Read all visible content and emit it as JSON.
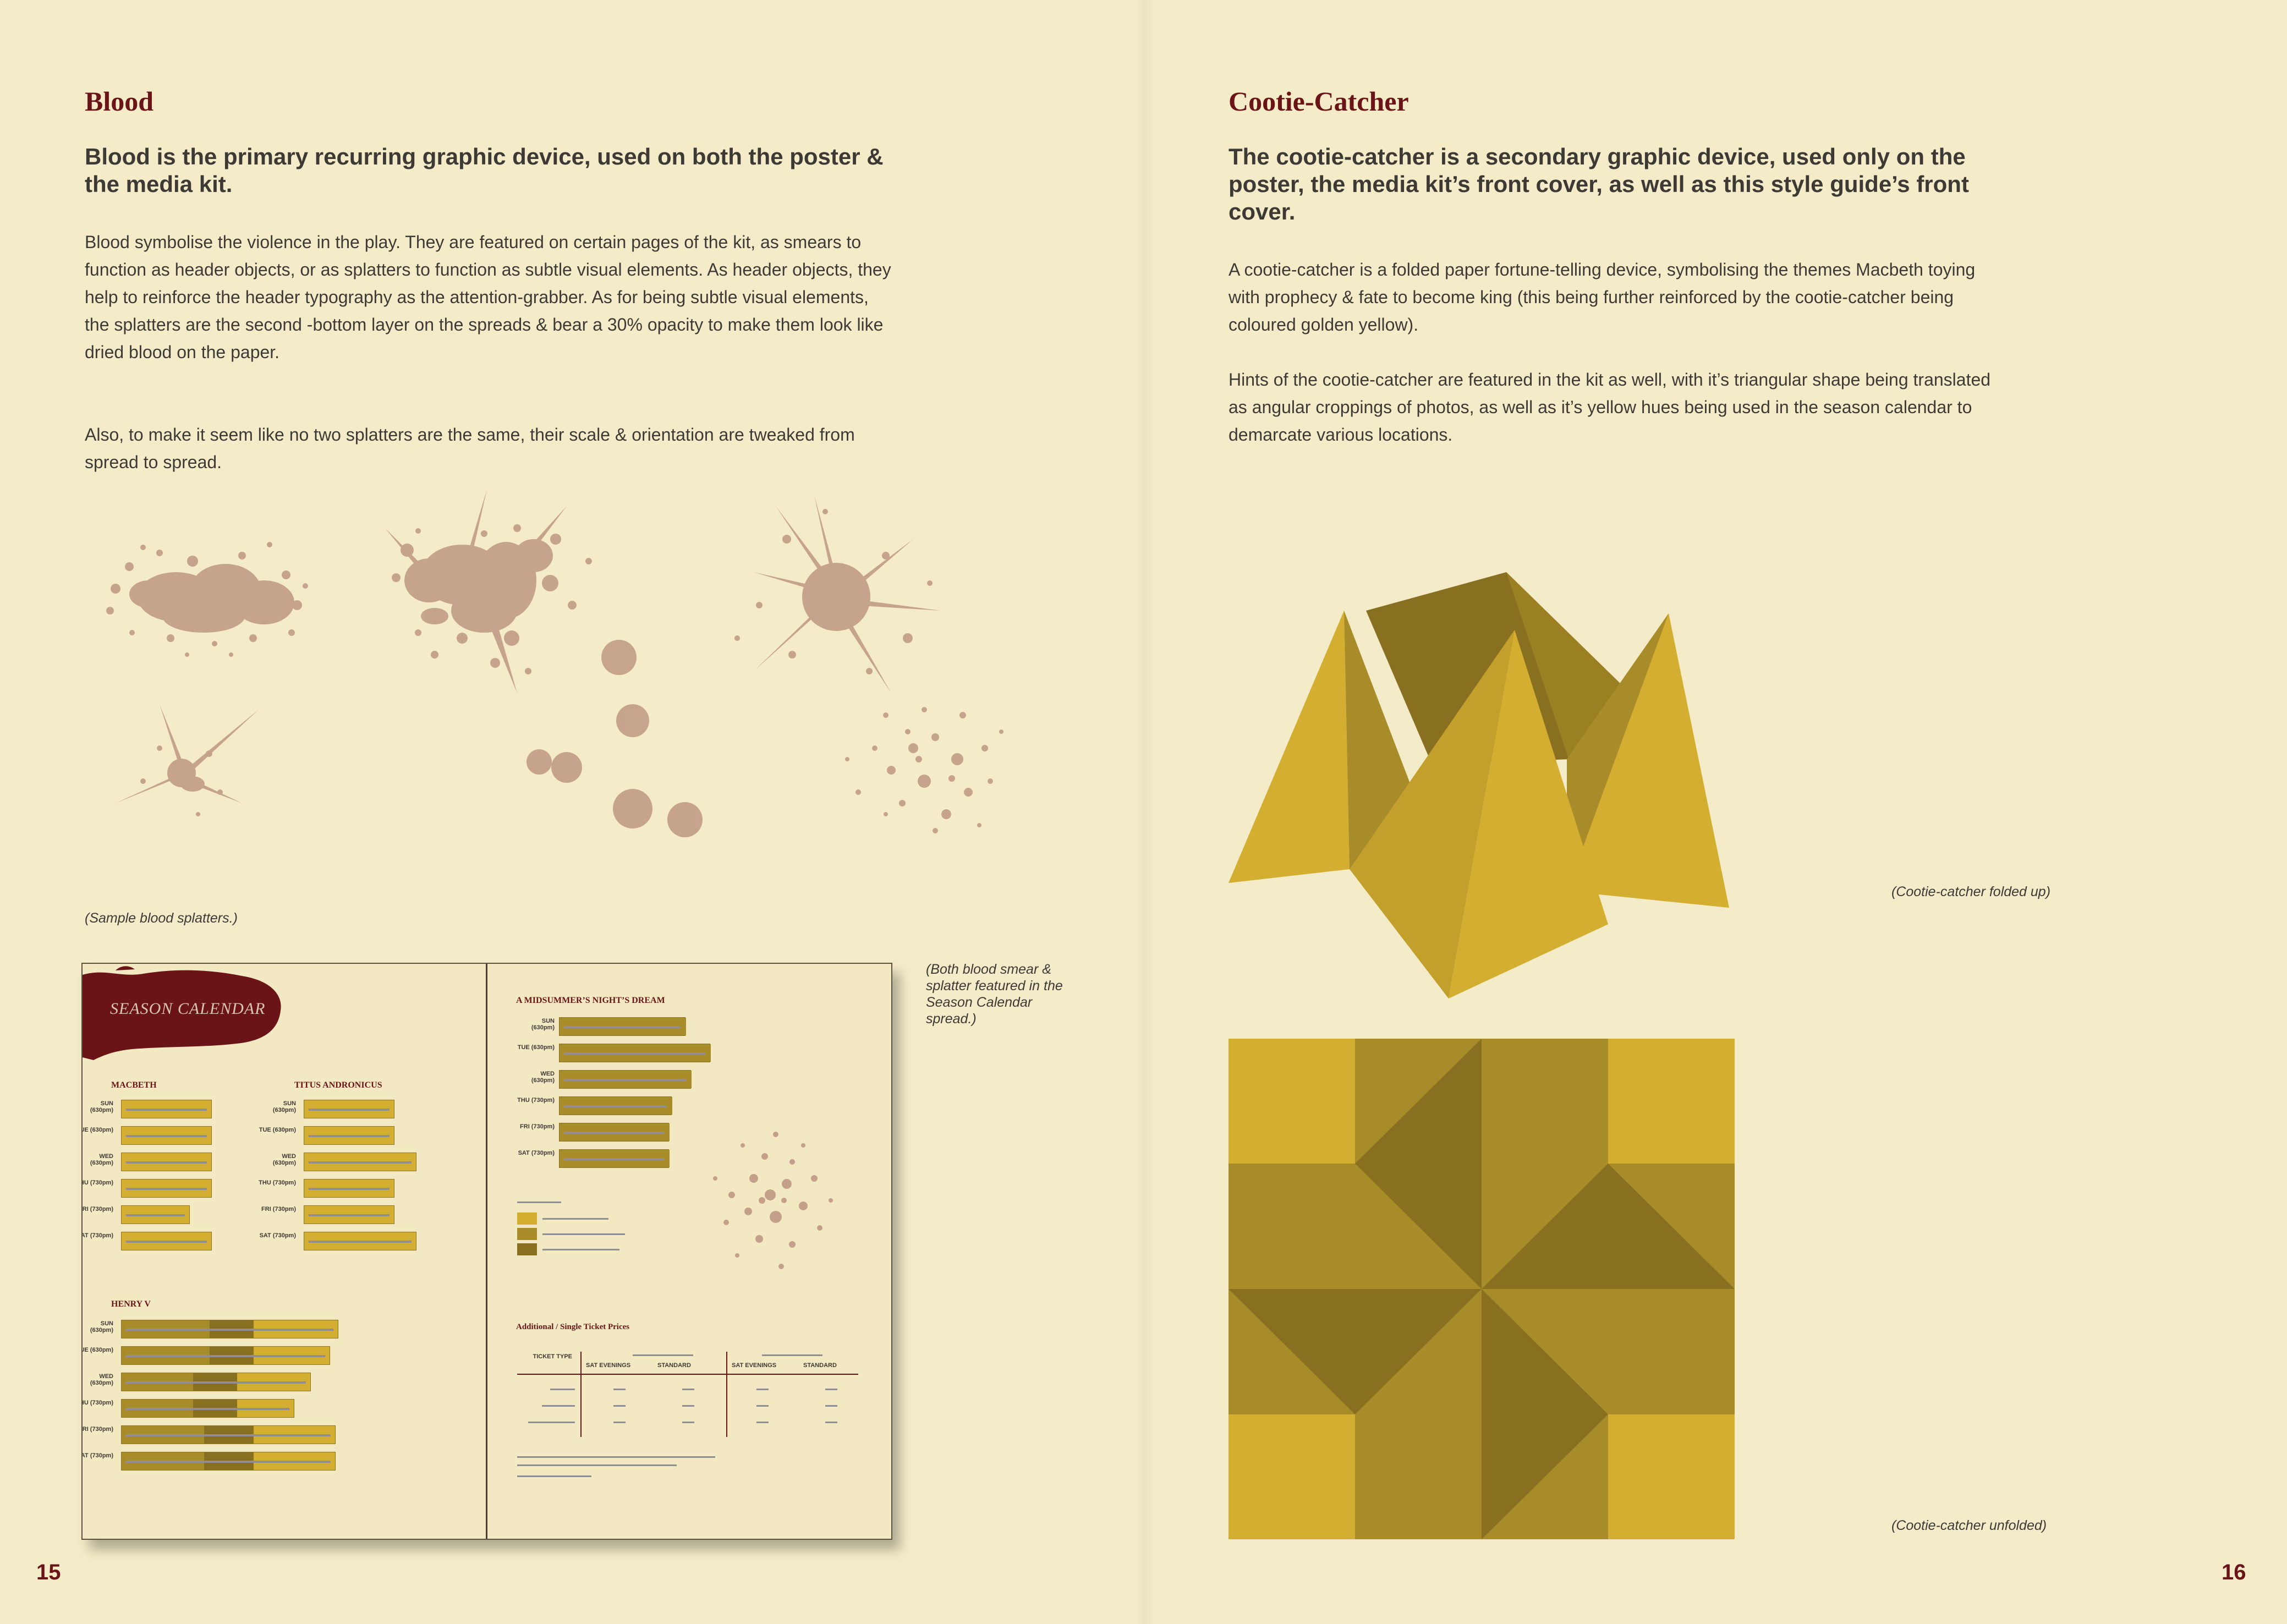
{
  "left": {
    "heading": "Blood",
    "lead": "Blood is the primary recurring graphic device, used on both the poster & the media kit.",
    "body1": "Blood symbolise the violence in the play. They are featured on certain pages of the kit, as smears to function as header objects, or as splatters to function as subtle visual elements. As header objects, they help to reinforce the header typography as the attention-grabber. As for being subtle visual elements, the splatters are the second -bottom layer on the spreads & bear a 30% opacity to make them look like dried blood on the paper.",
    "body2": "Also, to make it seem like no two splatters are the same, their scale & orientation are tweaked from spread to spread.",
    "splatter_caption": "(Sample blood splatters.)",
    "spread_caption": "(Both blood smear & splatter featured in the Season Calendar spread.)",
    "page_number": "15"
  },
  "right": {
    "heading": "Cootie-Catcher",
    "lead": "The cootie-catcher is a secondary graphic device, used only on the poster, the media kit’s front cover, as well as this style guide’s front cover.",
    "body1": "A cootie-catcher is a folded paper fortune-telling device, symbolising the themes Macbeth toying with prophecy & fate to become king (this being further reinforced by the cootie-catcher being coloured golden yellow).",
    "body2": "Hints of the cootie-catcher are featured in the kit as well, with it’s triangular shape being translated as angular croppings of photos, as well as it’s yellow hues being used in the season calendar to demarcate various locations.",
    "folded_caption": "(Cootie-catcher folded up)",
    "unfolded_caption": "(Cootie-catcher unfolded)",
    "page_number": "16"
  },
  "spread": {
    "title": "SEASON CALENDAR",
    "macbeth": "MACBETH",
    "titus": "TITUS ANDRONICUS",
    "henry": "HENRY V",
    "midsummer": "A MIDSUMMER’S NIGHT’S DREAM",
    "ticket_title": "Additional / Single Ticket Prices",
    "ticket_type": "TICKET TYPE",
    "sat_evenings": "SAT EVENINGS",
    "standard": "STANDARD",
    "days_630": [
      "SUN (630pm)",
      "TUE (630pm)",
      "WED (630pm)",
      "THU (730pm)",
      "FRI (730pm)",
      "SAT (730pm)"
    ],
    "days_all": [
      "SUN (630pm)",
      "TUE (630pm)",
      "WED (630pm)",
      "THU (730pm)",
      "FRI (730pm)",
      "SAT (730pm)"
    ]
  },
  "colors": {
    "paper": "#f4ecc8",
    "blood": "#6b1418",
    "splatter": "#c4a08a",
    "gold_light": "#d4ae31",
    "gold_mid": "#a88c2a",
    "gold_dark": "#887020",
    "text": "#3d3a36"
  }
}
